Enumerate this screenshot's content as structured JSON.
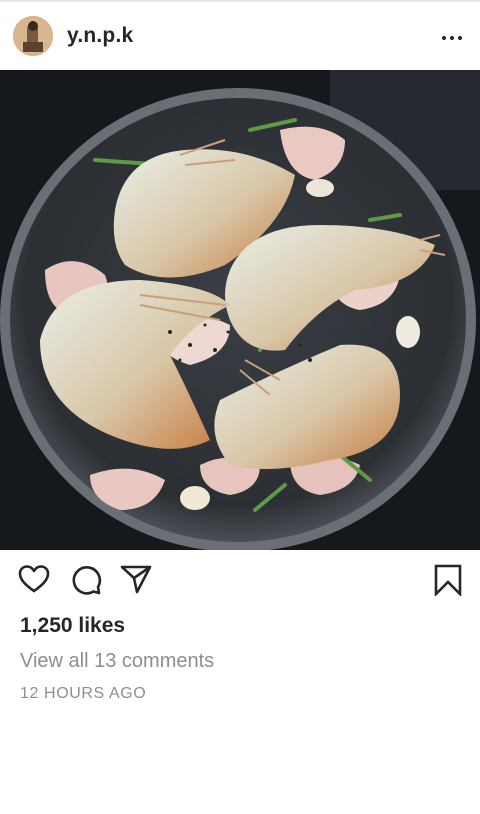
{
  "post": {
    "username": "y.n.p.k",
    "likes_text": "1,250 likes",
    "comments_link": "View all 13 comments",
    "timestamp": "12 HOURS AGO"
  },
  "icons": {
    "avatar": "avatar",
    "more": "more-options-icon",
    "like": "heart-icon",
    "comment": "comment-bubble-icon",
    "share": "paper-plane-icon",
    "save": "bookmark-icon"
  },
  "colors": {
    "text": "#262626",
    "secondary": "#8e8e8e",
    "divider": "#e6e6e6"
  }
}
